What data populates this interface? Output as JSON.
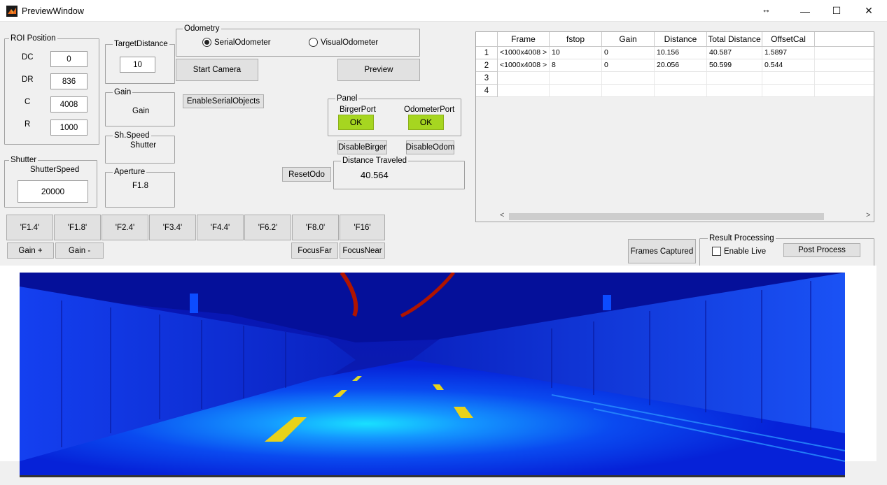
{
  "window": {
    "title": "PreviewWindow",
    "minimize": "—",
    "maximize": "☐",
    "close": "✕",
    "resize_hint": "↔"
  },
  "roi": {
    "title": "ROI Position",
    "fields": [
      {
        "label": "DC",
        "value": "0"
      },
      {
        "label": "DR",
        "value": "836"
      },
      {
        "label": "C",
        "value": "4008"
      },
      {
        "label": "R",
        "value": "1000"
      }
    ]
  },
  "target_distance": {
    "title": "TargetDistance",
    "value": "10"
  },
  "gain": {
    "title": "Gain",
    "text": "Gain"
  },
  "shspeed": {
    "title": "Sh.Speed",
    "text": "Shutter"
  },
  "aperture": {
    "title": "Aperture",
    "text": "F1.8"
  },
  "shutter": {
    "title": "Shutter",
    "label": "ShutterSpeed",
    "value": "20000"
  },
  "odometry": {
    "title": "Odometry",
    "options": [
      "SerialOdometer",
      "VisualOdometer"
    ],
    "selected": "SerialOdometer"
  },
  "buttons": {
    "start_camera": "Start Camera",
    "preview": "Preview",
    "enable_serial": "EnableSerialObjects",
    "disable_birger": "DisableBirger",
    "disable_odom": "DisableOdom",
    "reset_odo": "ResetOdo",
    "frames_captured": "Frames Captured",
    "post_process": "Post Process",
    "fstops": [
      "'F1.4'",
      "'F1.8'",
      "'F2.4'",
      "'F3.4'",
      "'F4.4'",
      "'F6.2'",
      "'F8.0'",
      "'F16'"
    ],
    "gain_plus": "Gain +",
    "gain_minus": "Gain -",
    "focus_far": "FocusFar",
    "focus_near": "FocusNear"
  },
  "panel": {
    "title": "Panel",
    "birger_label": "BirgerPort",
    "birger_status": "OK",
    "odometer_label": "OdometerPort",
    "odometer_status": "OK"
  },
  "distance": {
    "title": "Distance Traveled",
    "value": "40.564"
  },
  "result": {
    "title": "Result Processing",
    "enable_live": "Enable Live",
    "enable_live_checked": false
  },
  "table": {
    "columns": [
      "Frame",
      "fstop",
      "Gain",
      "Distance",
      "Total Distance",
      "OffsetCal"
    ],
    "row_headers": [
      "1",
      "2",
      "3",
      "4"
    ],
    "rows": [
      [
        "<1000x4008 >",
        "10",
        "0",
        "10.156",
        "40.587",
        "1.5897"
      ],
      [
        "<1000x4008 >",
        "8",
        "0",
        "20.056",
        "50.599",
        "0.544"
      ],
      [
        "",
        "",
        "",
        "",
        "",
        ""
      ],
      [
        "",
        "",
        "",
        "",
        "",
        ""
      ]
    ],
    "scroll_left": "<",
    "scroll_right": ">"
  },
  "colors": {
    "ok_green": "#a6d620",
    "image_blue": "#0a1fe0",
    "lane_yellow": "#e8d21a",
    "cable_red": "#b01400"
  },
  "preview_image": {
    "description_icon": "tunnel-road-colormap-image"
  }
}
